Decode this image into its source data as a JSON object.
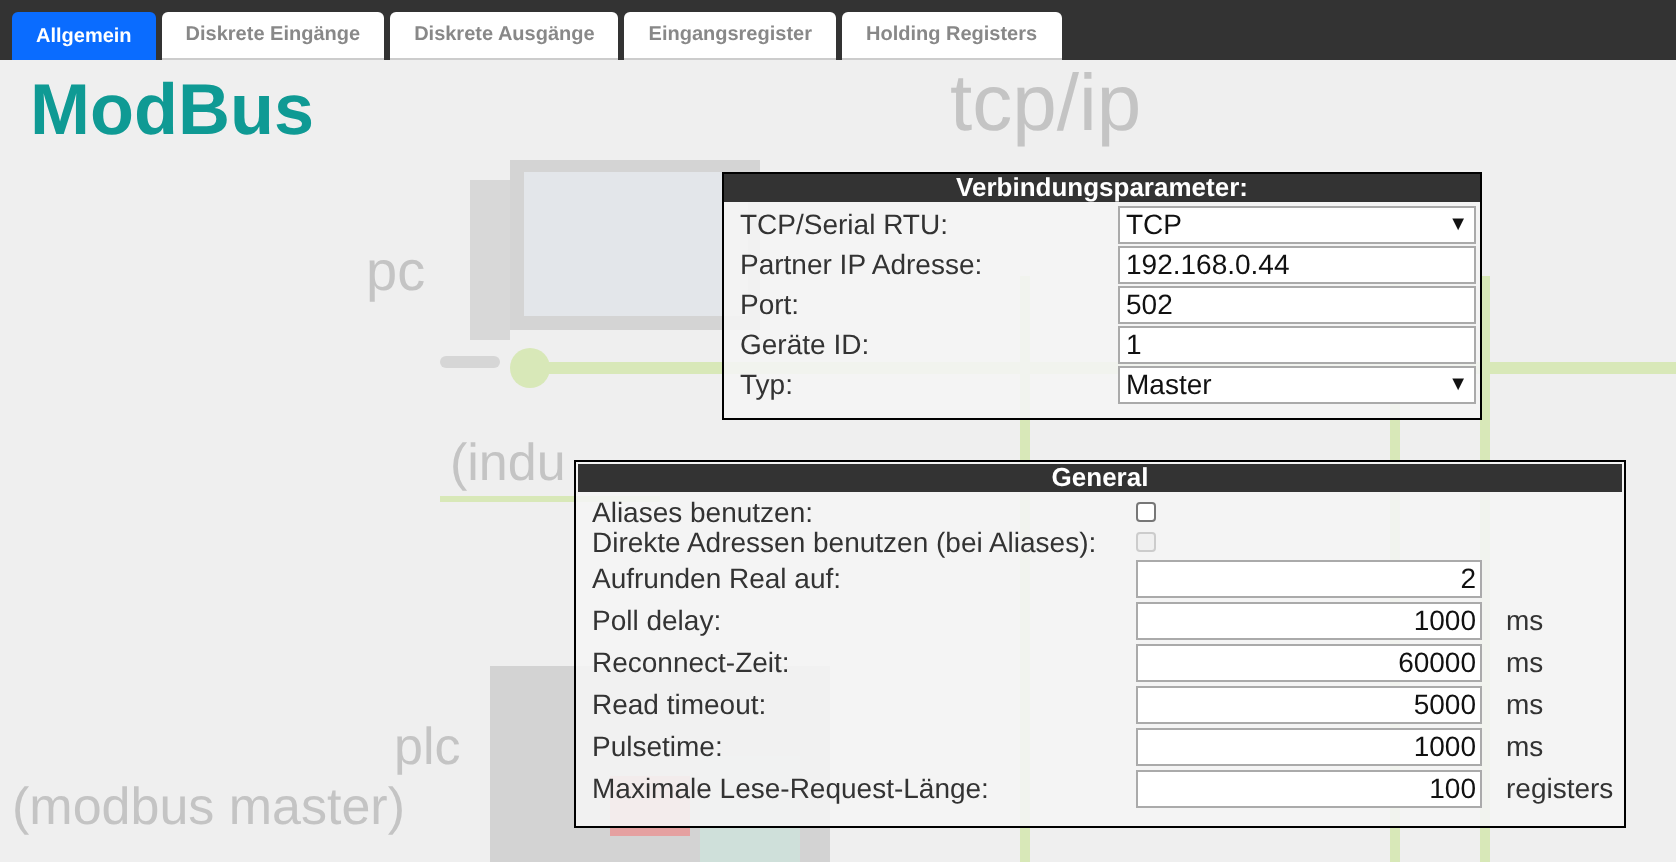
{
  "tabs": [
    {
      "label": "Allgemein",
      "selected": true
    },
    {
      "label": "Diskrete Eingänge",
      "selected": false
    },
    {
      "label": "Diskrete Ausgänge",
      "selected": false
    },
    {
      "label": "Eingangsregister",
      "selected": false
    },
    {
      "label": "Holding Registers",
      "selected": false
    }
  ],
  "title": "ModBus",
  "diagram_labels": [
    {
      "kind": "big",
      "text": "tcp/ip"
    },
    {
      "kind": "pc",
      "text": "pc"
    },
    {
      "kind": "eth",
      "text": "(indu"
    },
    {
      "kind": "plc",
      "text": "plc"
    },
    {
      "kind": "master",
      "text": "(modbus master)"
    }
  ],
  "connection": {
    "heading": "Verbindungsparameter:",
    "rows": [
      {
        "label": "TCP/Serial RTU:",
        "kind": "select",
        "value": "TCP",
        "arrow": "▼"
      },
      {
        "label": "Partner IP Adresse:",
        "kind": "text",
        "value": "192.168.0.44"
      },
      {
        "label": "Port:",
        "kind": "text",
        "value": "502"
      },
      {
        "label": "Geräte ID:",
        "kind": "text",
        "value": "1"
      },
      {
        "label": "Typ:",
        "kind": "select",
        "value": "Master",
        "arrow": "▼"
      }
    ]
  },
  "general": {
    "heading": "General",
    "rows": [
      {
        "label": "Aliases benutzen:",
        "kind": "checkbox",
        "checked": false,
        "disabled": false
      },
      {
        "label": "Direkte Adressen benutzen (bei Aliases):",
        "kind": "checkbox",
        "checked": false,
        "disabled": true
      },
      {
        "label": "Aufrunden Real auf:",
        "kind": "number",
        "value": "2"
      },
      {
        "label": "Poll delay:",
        "kind": "number",
        "value": "1000",
        "unit": "ms"
      },
      {
        "label": "Reconnect-Zeit:",
        "kind": "number",
        "value": "60000",
        "unit": "ms"
      },
      {
        "label": "Read timeout:",
        "kind": "number",
        "value": "5000",
        "unit": "ms"
      },
      {
        "label": "Pulsetime:",
        "kind": "number",
        "value": "1000",
        "unit": "ms"
      },
      {
        "label": "Maximale Lese-Request-Länge:",
        "kind": "number",
        "value": "100",
        "unit": "registers"
      }
    ]
  }
}
